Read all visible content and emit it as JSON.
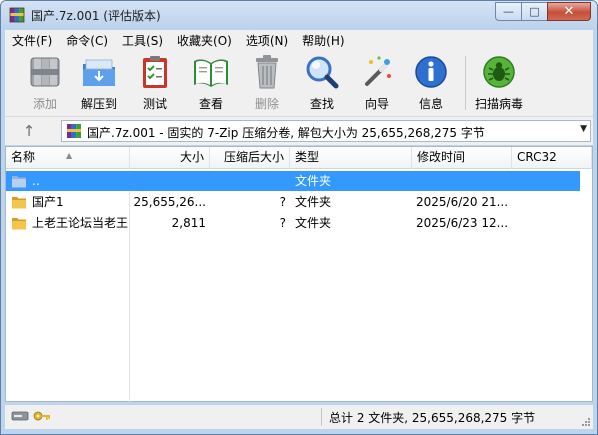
{
  "window": {
    "title": "国产.7z.001 (评估版本)",
    "controls": {
      "minimize": "—",
      "maximize": "□",
      "close": "✕"
    }
  },
  "menu": [
    {
      "label": "文件(F)"
    },
    {
      "label": "命令(C)"
    },
    {
      "label": "工具(S)"
    },
    {
      "label": "收藏夹(O)"
    },
    {
      "label": "选项(N)"
    },
    {
      "label": "帮助(H)"
    }
  ],
  "toolbar": {
    "add": "添加",
    "extract": "解压到",
    "test": "测试",
    "view": "查看",
    "delete": "删除",
    "find": "查找",
    "wizard": "向导",
    "info": "信息",
    "virus_scan": "扫描病毒"
  },
  "address": {
    "up_glyph": "↑",
    "path": "国产.7z.001 - 固实的 7-Zip 压缩分卷, 解包大小为 25,655,268,275 字节",
    "dropdown_glyph": "▼"
  },
  "columns": {
    "name": "名称",
    "size": "大小",
    "packed": "压缩后大小",
    "type": "类型",
    "modified": "修改时间",
    "crc": "CRC32"
  },
  "rows": [
    {
      "name": "..",
      "size": "",
      "packed": "",
      "type": "文件夹",
      "modified": "",
      "crc": "",
      "selected": true
    },
    {
      "name": "国产1",
      "size": "25,655,26...",
      "packed": "?",
      "type": "文件夹",
      "modified": "2025/6/20 21...",
      "crc": ""
    },
    {
      "name": "上老王论坛当老王",
      "size": "2,811",
      "packed": "?",
      "type": "文件夹",
      "modified": "2025/6/23 12...",
      "crc": ""
    }
  ],
  "status": {
    "summary": "总计 2 文件夹, 25,655,268,275 字节"
  },
  "colors": {
    "selection": "#3399ff",
    "frame": "#bcd4ee",
    "close_button": "#c4503a",
    "folder": "#e8b93c"
  }
}
